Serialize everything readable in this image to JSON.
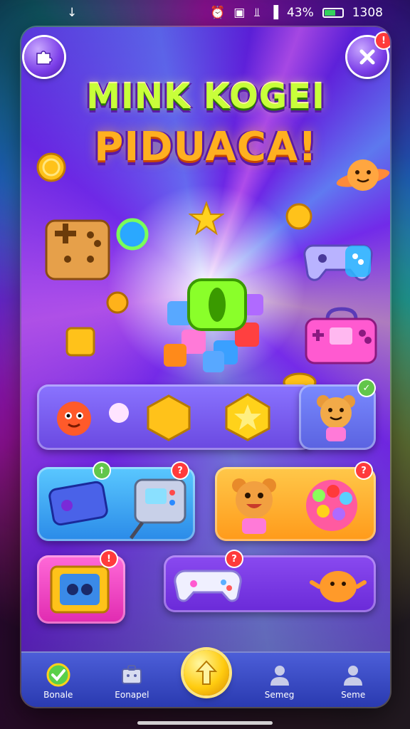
{
  "status_bar": {
    "battery_text": "43%",
    "time": "1308",
    "battery_level": 0.43
  },
  "header": {
    "title_line1": "MINK KOGEI",
    "title_line2": "PIDUACA!",
    "left_button_icon": "puzzle-icon",
    "right_button_icon": "close-icon",
    "right_button_badge": "!"
  },
  "panels": [
    {
      "name": "panel-row1-wide",
      "color": "#7b6cf0",
      "badge": null
    },
    {
      "name": "panel-row1-small",
      "color": "#6a7cff",
      "badge": "✓"
    },
    {
      "name": "panel-row2-blue",
      "color": "#3fa8ff",
      "badge": "↑"
    },
    {
      "name": "panel-row2-orange",
      "color": "#ffb42a",
      "badge": "?"
    },
    {
      "name": "panel-row3-pink",
      "color": "#ff48c8",
      "badge": "!"
    },
    {
      "name": "panel-row3-purple",
      "color": "#7a3cf0",
      "badge": "?"
    }
  ],
  "badges": {
    "row1_small": "?",
    "row2_left": "↑",
    "row2_mid": "?",
    "row2_right": "?",
    "row3_left": "!",
    "row3_right": "?"
  },
  "bottom_nav": {
    "items": [
      {
        "label": "Bonale",
        "icon": "check-shield-icon"
      },
      {
        "label": "Eonapel",
        "icon": "briefcase-icon"
      },
      {
        "label": "Semeg",
        "icon": "person-icon"
      },
      {
        "label": "Seme",
        "icon": "person-icon"
      }
    ],
    "center_icon": "arrow-up-icon"
  },
  "colors": {
    "title_green": "#c8ff3a",
    "title_orange": "#ffb020",
    "nav_bg": "#3a4cc4",
    "accent_gold": "#ffcc10"
  }
}
